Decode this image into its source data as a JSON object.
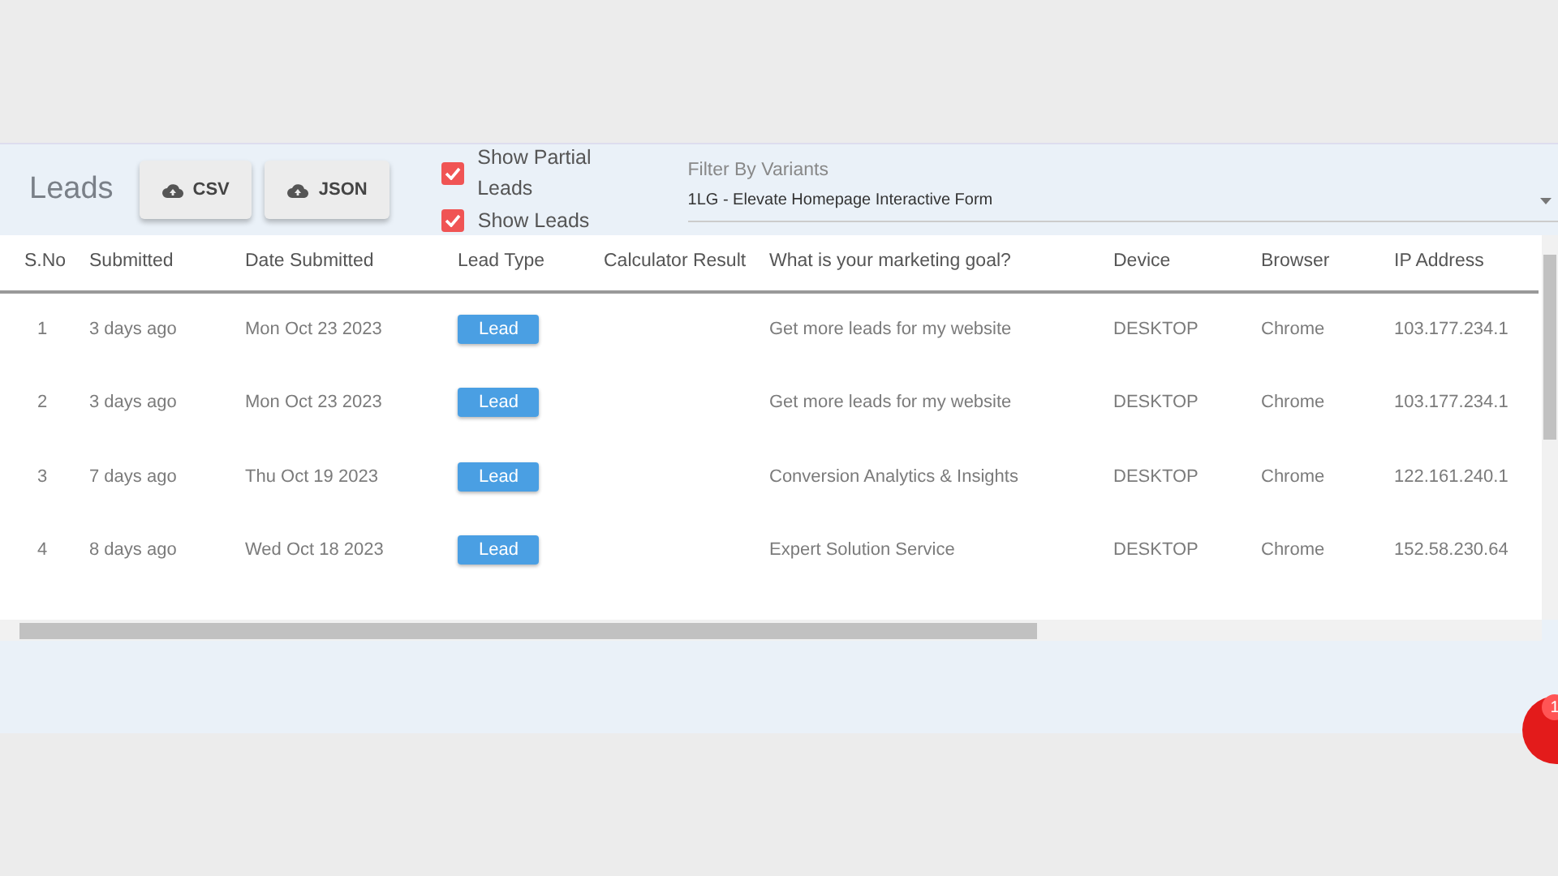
{
  "header": {
    "title": "Leads",
    "export_buttons": [
      "CSV",
      "JSON"
    ],
    "checkboxes": [
      {
        "label": "Show Partial Leads",
        "checked": true
      },
      {
        "label": "Show Leads",
        "checked": true
      }
    ],
    "filter": {
      "label": "Filter By Variants",
      "value": "1LG - Elevate Homepage Interactive Form"
    }
  },
  "table": {
    "columns": [
      "S.No",
      "Submitted",
      "Date Submitted",
      "Lead Type",
      "Calculator Result",
      "What is your marketing goal?",
      "Device",
      "Browser",
      "IP Address"
    ],
    "rows": [
      {
        "sno": "1",
        "submitted": "3 days ago",
        "date": "Mon Oct 23 2023",
        "lead_type": "Lead",
        "calculator_result": "",
        "goal": "Get more leads for my website",
        "device": "DESKTOP",
        "browser": "Chrome",
        "ip": "103.177.234.1"
      },
      {
        "sno": "2",
        "submitted": "3 days ago",
        "date": "Mon Oct 23 2023",
        "lead_type": "Lead",
        "calculator_result": "",
        "goal": "Get more leads for my website",
        "device": "DESKTOP",
        "browser": "Chrome",
        "ip": "103.177.234.1"
      },
      {
        "sno": "3",
        "submitted": "7 days ago",
        "date": "Thu Oct 19 2023",
        "lead_type": "Lead",
        "calculator_result": "",
        "goal": "Conversion Analytics & Insights",
        "device": "DESKTOP",
        "browser": "Chrome",
        "ip": "122.161.240.1"
      },
      {
        "sno": "4",
        "submitted": "8 days ago",
        "date": "Wed Oct 18 2023",
        "lead_type": "Lead",
        "calculator_result": "",
        "goal": "Expert Solution Service",
        "device": "DESKTOP",
        "browser": "Chrome",
        "ip": "152.58.230.64"
      }
    ]
  },
  "chat_widget": {
    "badge": "1"
  }
}
